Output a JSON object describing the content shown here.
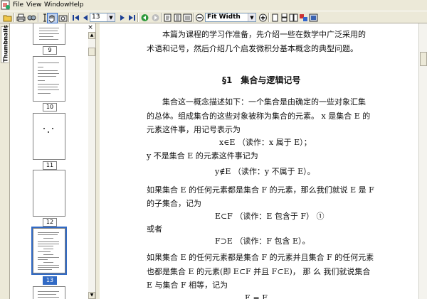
{
  "menubar": {
    "items": [
      "File",
      "View",
      "Window",
      "Help"
    ]
  },
  "toolbar": {
    "page_number": "13",
    "zoom": "Fit Width",
    "icons": [
      "open-icon",
      "print-icon",
      "find-icon",
      "hand-tool-icon",
      "select-text-icon",
      "snapshot-icon",
      "first-page-icon",
      "previous-page-icon",
      "next-page-icon",
      "last-page-icon",
      "go-back-icon",
      "go-forward-icon",
      "zoom-out-icon",
      "zoom-in-icon",
      "actual-size-icon",
      "fit-page-icon",
      "fit-width-icon",
      "rotate-icon",
      "continuous-icon"
    ]
  },
  "tabs": {
    "thumbnails": "Thumbnails"
  },
  "thumbnails": {
    "close_label": "×",
    "pages": [
      {
        "label": "9"
      },
      {
        "label": "10"
      },
      {
        "label": "11"
      },
      {
        "label": "12"
      },
      {
        "label": "13",
        "selected": true
      }
    ]
  },
  "document": {
    "intro_1": "本篇为课程的学习作准备，先介绍一些在数学中广泛采用的",
    "intro_2": "术语和记号，然后介绍几个启发微积分基本概念的典型问题。",
    "section_title": "§1　集合与逻辑记号",
    "p1_1": "集合这一概念描述如下：一个集合是由确定的一些对象汇集",
    "p1_2": "的总体。组成集合的这些对象被称为集合的元素。 x 是集合 E 的",
    "p1_3": "元素这件事，用记号表示为",
    "f1": "x∈E （读作：x 属于 E）；",
    "p2": "y 不是集合 E 的元素这件事记为",
    "f2": "y∉E （读作：y 不属于 E）。",
    "p3_1": "如果集合 E 的任何元素都是集合 F 的元素，那么我们就说 E 是 F",
    "p3_2": "的子集合，记为",
    "f3": "E⊂F （读作：E 包含于 F） ①",
    "p4": "或者",
    "f4": "F⊃E （读作：F 包含 E）。",
    "p5_1": "如果集合 E 的任何元素都是集合 F 的元素并且集合 F 的任何元素",
    "p5_2": "也都是集合 E 的元素(即 E⊂F 并且 F⊂E)， 那 么 我们就说集合",
    "p5_3": "E 与集合 F 相等，记为",
    "f5": "E = F"
  },
  "colors": {
    "selection": "#316ac5",
    "chrome": "#ece9d8"
  }
}
